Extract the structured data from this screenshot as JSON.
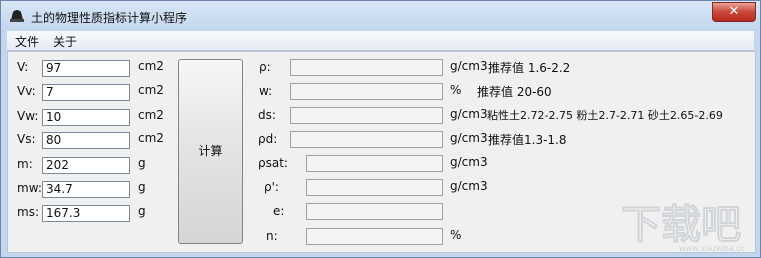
{
  "window": {
    "title": "土的物理性质指标计算小程序",
    "close": "✕"
  },
  "menu": [
    "文件",
    "关于"
  ],
  "inputs": [
    {
      "label": "V:",
      "value": "97",
      "unit": "cm2"
    },
    {
      "label": "Vv:",
      "value": "7",
      "unit": "cm2"
    },
    {
      "label": "Vw:",
      "value": "10",
      "unit": "cm2"
    },
    {
      "label": "Vs:",
      "value": "80",
      "unit": "cm2"
    },
    {
      "label": "m:",
      "value": "202",
      "unit": "g"
    },
    {
      "label": "mw:",
      "value": "34.7",
      "unit": "g"
    },
    {
      "label": "ms:",
      "value": "167.3",
      "unit": "g"
    }
  ],
  "calc_label": "计算",
  "outputs": [
    {
      "label": "ρ:",
      "value": "",
      "unit": "g/cm3",
      "note": "推荐值 1.6-2.2"
    },
    {
      "label": "w:",
      "value": "",
      "unit": "%",
      "note": "推荐值 20-60"
    },
    {
      "label": "ds:",
      "value": "",
      "unit": "g/cm3",
      "note": "粘性土2.72-2.75 粉土2.7-2.71 砂土2.65-2.69"
    },
    {
      "label": "ρd:",
      "value": "",
      "unit": "g/cm3",
      "note": "推荐值1.3-1.8"
    },
    {
      "label": "ρsat:",
      "value": "",
      "unit": "g/cm3",
      "note": ""
    },
    {
      "label": "ρ':",
      "value": "",
      "unit": "g/cm3",
      "note": ""
    },
    {
      "label": "e:",
      "value": "",
      "unit": "",
      "note": ""
    },
    {
      "label": "n:",
      "value": "",
      "unit": "%",
      "note": ""
    }
  ],
  "watermark": "下载吧",
  "watermark_url": "www.xiazaiba.com"
}
